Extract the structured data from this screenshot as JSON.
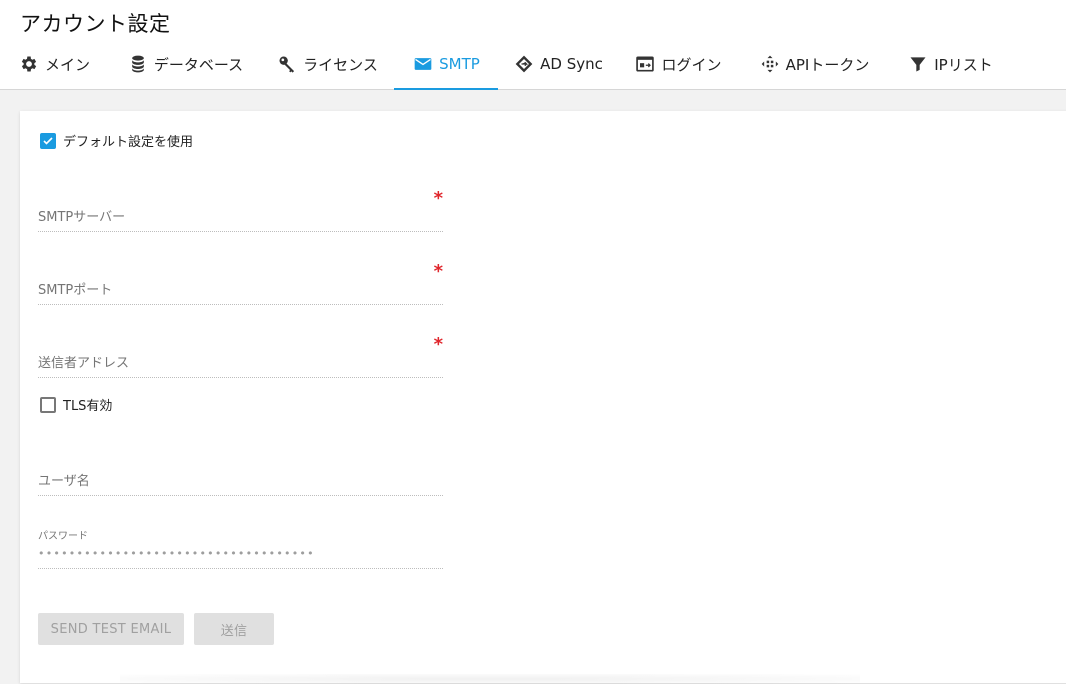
{
  "page": {
    "title": "アカウント設定"
  },
  "tabs": [
    {
      "label": "メイン",
      "icon": "gear-icon"
    },
    {
      "label": "データベース",
      "icon": "database-icon"
    },
    {
      "label": "ライセンス",
      "icon": "key-icon"
    },
    {
      "label": "SMTP",
      "icon": "envelope-icon",
      "active": true
    },
    {
      "label": "AD Sync",
      "icon": "ad-sync-icon"
    },
    {
      "label": "ログイン",
      "icon": "id-card-icon"
    },
    {
      "label": "APIトークン",
      "icon": "api-icon"
    },
    {
      "label": "IPリスト",
      "icon": "filter-icon"
    }
  ],
  "form": {
    "use_default_label": "デフォルト設定を使用",
    "use_default_checked": true,
    "smtp_server_label": "SMTPサーバー",
    "smtp_port_label": "SMTPポート",
    "sender_address_label": "送信者アドレス",
    "required_mark": "*",
    "tls_label": "TLS有効",
    "tls_checked": false,
    "username_label": "ユーザ名",
    "password_label": "パスワード",
    "password_value": "••••••••••••••••••••••••••••••••••••"
  },
  "buttons": {
    "send_test_email": "SEND TEST EMAIL",
    "send": "送信"
  },
  "colors": {
    "accent": "#1a9be0",
    "required": "#e0262c",
    "disabled_button_bg": "#e0e0e0",
    "disabled_button_text": "#a0a0a0"
  }
}
